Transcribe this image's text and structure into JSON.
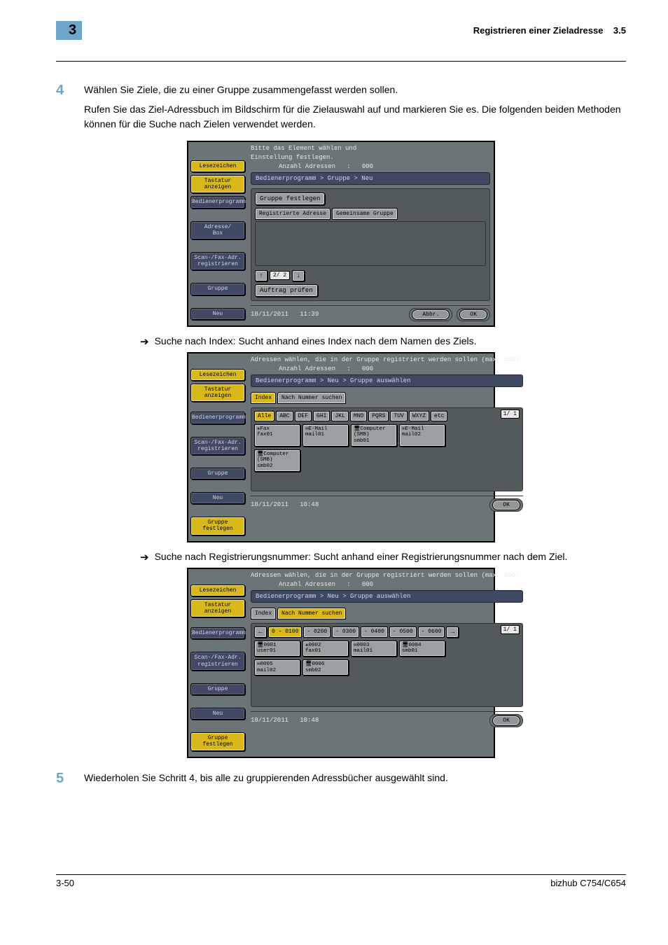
{
  "header": {
    "chapter_number": "3",
    "title": "Registrieren einer Zieladresse",
    "section": "3.5"
  },
  "step4": {
    "num": "4",
    "p1": "Wählen Sie Ziele, die zu einer Gruppe zusammengefasst werden sollen.",
    "p2": "Rufen Sie das Ziel-Adressbuch im Bildschirm für die Zielauswahl auf und markieren Sie es. Die folgenden beiden Methoden können für die Suche nach Zielen verwendet werden."
  },
  "bullet1": "Suche nach Index: Sucht anhand eines Index nach dem Namen des Ziels.",
  "bullet2": "Suche nach Registrierungsnummer: Sucht anhand einer Registrierungsnummer nach dem Ziel.",
  "step5": {
    "num": "5",
    "p1": "Wiederholen Sie Schritt 4, bis alle zu gruppierenden Adressbücher ausgewählt sind."
  },
  "screen1": {
    "msg1": "Bitte das Element wählen und",
    "msg2": "Einstellung festlegen.",
    "countLabel": "Anzahl Adressen   :   000",
    "breadcrumb": "Bedienerprogramm > Gruppe > Neu",
    "group_set": "Gruppe festlegen",
    "tab_reg": "Registrierte Adresse",
    "tab_gem": "Gemeinsame Gruppe",
    "pg": "2/ 2",
    "check": "Auftrag prüfen",
    "side": {
      "lesezeichen": "Lesezeichen",
      "tastatur": "Tastatur\nanzeigen",
      "bed": "Bedienerprogramm",
      "adrbox": "Adresse/\nBox",
      "scan": "Scan-/Fax-Adr.\nregistrieren",
      "gruppe": "Gruppe",
      "neu": "Neu"
    },
    "date": "18/11/2011",
    "time": "11:39",
    "abbr": "Abbr.",
    "ok": "OK"
  },
  "screen2": {
    "msg": "Adressen wählen, die in der Gruppe registriert werden sollen (max. 500).",
    "countLabel": "Anzahl Adressen   :   000",
    "breadcrumb": "Bedienerprogramm > Neu > Gruppe auswählen",
    "tabIndex": "Index",
    "tabNum": "Nach Nummer suchen",
    "idx": [
      "Alle",
      "ABC",
      "DEF",
      "GHI",
      "JKL",
      "MNO",
      "PQRS",
      "TUV",
      "WXYZ",
      "etc"
    ],
    "cards": [
      "⚹Fax\nfax01",
      "✉E-Mail\nmail01",
      "🖥Computer\n(SMB)\nsmb01",
      "✉E-Mail\nmail02",
      "🖥Computer\n(SMB)\nsmb02"
    ],
    "pg": "1/  1",
    "side": {
      "lesezeichen": "Lesezeichen",
      "tastatur": "Tastatur\nanzeigen",
      "bed": "Bedienerprogramm",
      "scan": "Scan-/Fax-Adr.\nregistrieren",
      "gruppe": "Gruppe",
      "neu": "Neu",
      "gf": "Gruppe festlegen"
    },
    "date": "18/11/2011",
    "time": "10:48",
    "ok": "OK"
  },
  "screen3": {
    "msg": "Adressen wählen, die in der Gruppe registriert werden sollen (max. 500).",
    "countLabel": "Anzahl Adressen   :   000",
    "breadcrumb": "Bedienerprogramm > Neu > Gruppe auswählen",
    "tabIndex": "Index",
    "tabNum": "Nach Nummer suchen",
    "ranges": [
      "0 - 0100",
      "-  0200",
      "-  0300",
      "-  0400",
      "-  0500",
      "-  0600"
    ],
    "cards": [
      "🖥0001\nuser01",
      "⚹0002\nfax01",
      "✉0003\nmail01",
      "🖥0004\nsmb01",
      "✉0005\nmail02",
      "🖥0006\nsmb02"
    ],
    "pg": "1/  1",
    "side": {
      "lesezeichen": "Lesezeichen",
      "tastatur": "Tastatur\nanzeigen",
      "bed": "Bedienerprogramm",
      "scan": "Scan-/Fax-Adr.\nregistrieren",
      "gruppe": "Gruppe",
      "neu": "Neu",
      "gf": "Gruppe festlegen"
    },
    "date": "18/11/2011",
    "time": "10:48",
    "ok": "OK"
  },
  "pagefoot": {
    "left": "3-50",
    "right": "bizhub C754/C654"
  }
}
